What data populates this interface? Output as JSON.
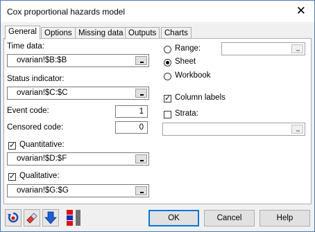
{
  "window": {
    "title": "Cox proportional hazards model",
    "close_glyph": "✕"
  },
  "tabs": [
    "General",
    "Options",
    "Missing data",
    "Outputs",
    "Charts"
  ],
  "general": {
    "time_data_label": "Time data:",
    "time_data_value": "ovarian!$B:$B",
    "status_label": "Status indicator:",
    "status_value": "ovarian!$C:$C",
    "event_code_label": "Event code:",
    "event_code_value": "1",
    "censored_code_label": "Censored code:",
    "censored_code_value": "0",
    "quantitative_label": "Quantitative:",
    "quantitative_checked": true,
    "quantitative_value": "ovarian!$D:$F",
    "qualitative_label": "Qualitative:",
    "qualitative_checked": true,
    "qualitative_value": "ovarian!$G:$G",
    "output_options": [
      {
        "label": "Range:",
        "selected": false
      },
      {
        "label": "Sheet",
        "selected": true
      },
      {
        "label": "Workbook",
        "selected": false
      }
    ],
    "range_value": "",
    "column_labels_label": "Column labels",
    "column_labels_checked": true,
    "strata_label": "Strata:",
    "strata_checked": false,
    "strata_value": ""
  },
  "buttons": {
    "ok": "OK",
    "cancel": "Cancel",
    "help": "Help"
  },
  "toolbar_icons": [
    "reset-icon",
    "eraser-icon",
    "down-arrow-icon",
    "color-swatch-icon"
  ],
  "colors": {
    "accent": "#0078d7",
    "window_border": "#4a7bb7",
    "dialog_bg": "#f0f0f0"
  }
}
